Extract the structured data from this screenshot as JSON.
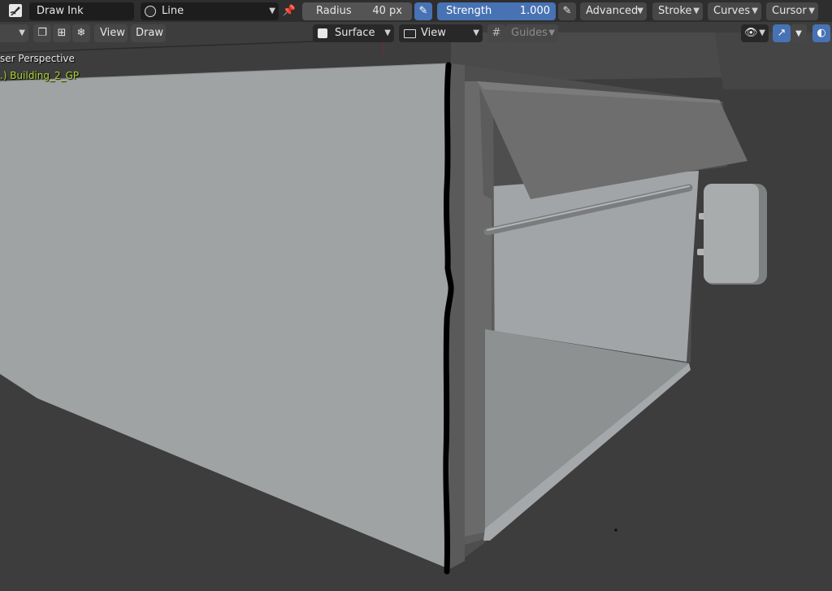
{
  "tool_header": {
    "brush_name": "Draw Ink",
    "stroke_type": "Line",
    "radius_label": "Radius",
    "radius_value": "40 px",
    "strength_label": "Strength",
    "strength_value": "1.000",
    "strength_fraction": 1.0,
    "menus": [
      "Advanced",
      "Stroke",
      "Curves",
      "Cursor"
    ]
  },
  "view_header": {
    "view_label": "View",
    "draw_label": "Draw",
    "placement": "Surface",
    "orientation": "View",
    "guides_label": "Guides"
  },
  "viewport": {
    "view_name": "ser Perspective",
    "object_name": ".) Building_2_GP",
    "object_name_color": "#b0d230"
  },
  "icons": {
    "editor": "grease-pencil-draw-icon",
    "brush": "brush-circle-icon",
    "pin": "pin-icon",
    "radius_pressure": "pen-pressure-icon",
    "strength_pressure": "pen-pressure-icon",
    "visibility": "eye-icon",
    "gizmo": "gizmo-icon",
    "overlay": "overlay-icon"
  },
  "colors": {
    "accent": "#4772b3",
    "header_bg": "#2e2e2e",
    "viewport_bg": "#3d3d3d",
    "stroke": "#000000"
  }
}
